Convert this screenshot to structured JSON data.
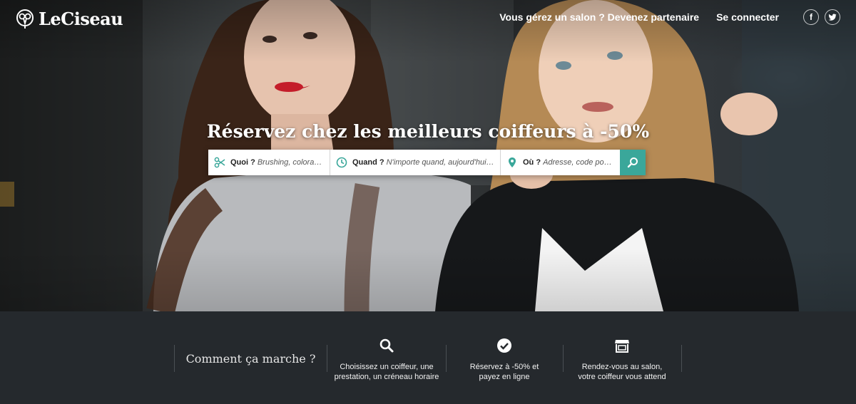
{
  "brand": {
    "name": "LeCiseau"
  },
  "nav": {
    "partner_link": "Vous gérez un salon ? Devenez partenaire",
    "login_link": "Se connecter",
    "social": [
      {
        "icon": "facebook-icon",
        "label": "f"
      },
      {
        "icon": "twitter-icon",
        "label": ""
      }
    ]
  },
  "hero": {
    "headline": "Réservez chez les meilleurs coiffeurs à -50%"
  },
  "search": {
    "what": {
      "icon": "scissors-icon",
      "label": "Quoi ?",
      "placeholder": "Brushing, coloration ..."
    },
    "when": {
      "icon": "clock-icon",
      "label": "Quand ?",
      "placeholder": "N'importe quand, aujourd'hui, demain ..."
    },
    "where": {
      "icon": "map-pin-icon",
      "label": "Où ?",
      "placeholder": "Adresse, code postal, ville"
    },
    "button_icon": "search-icon"
  },
  "how_it_works": {
    "title": "Comment ça marche ?",
    "steps": [
      {
        "icon": "search-icon",
        "line1": "Choisissez un coiffeur, une",
        "line2": "prestation, un créneau horaire"
      },
      {
        "icon": "check-circle-icon",
        "line1": "Réservez à -50% et",
        "line2": "payez en ligne"
      },
      {
        "icon": "storefront-icon",
        "line1": "Rendez-vous au salon,",
        "line2": "votre coiffeur vous attend"
      }
    ]
  },
  "colors": {
    "accent": "#3aa79a",
    "footer_bg": "#25292d"
  }
}
